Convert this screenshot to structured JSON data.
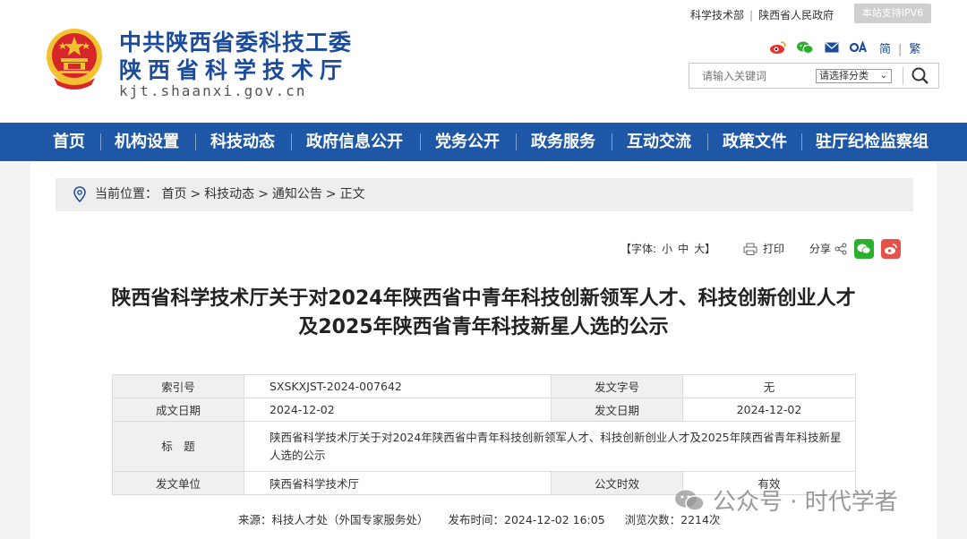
{
  "site": {
    "title_line1": "中共陕西省委科技工委",
    "title_line2": "陕西省科学技术厅",
    "url": "kjt.shaanxi.gov.cn"
  },
  "toplinks": {
    "link1": "科学技术部",
    "link2": "陕西省人民政府",
    "ipv6": "本站支持IPV6"
  },
  "lang": {
    "simplified": "简",
    "traditional": "繁"
  },
  "search": {
    "placeholder": "请输入关键词",
    "category": "请选择分类"
  },
  "nav": [
    "首页",
    "机构设置",
    "科技动态",
    "政府信息公开",
    "党务公开",
    "政务服务",
    "互动交流",
    "政策文件",
    "驻厅纪检监察组"
  ],
  "breadcrumb": {
    "label": "当前位置：",
    "items": [
      "首页",
      "科技动态",
      "通知公告",
      "正文"
    ],
    "sep": ">"
  },
  "tools": {
    "font_label": "【字体:",
    "small": "小",
    "medium": "中",
    "large": "大】",
    "print": "打印",
    "share": "分享"
  },
  "article": {
    "title_line1": "陕西省科学技术厅关于对2024年陕西省中青年科技创新领军人才、科技创新创业人才",
    "title_line2": "及2025年陕西省青年科技新星人选的公示"
  },
  "meta": {
    "index_label": "索引号",
    "index_value": "SXSKXJST-2024-007642",
    "docno_label": "发文字号",
    "docno_value": "无",
    "date_label": "成文日期",
    "date_value": "2024-12-02",
    "pubdate_label": "发文日期",
    "pubdate_value": "2024-12-02",
    "subject_label": "标　题",
    "subject_value": "陕西省科学技术厅关于对2024年陕西省中青年科技创新领军人才、科技创新创业人才及2025年陕西省青年科技新星人选的公示",
    "issuer_label": "发文单位",
    "issuer_value": "陕西省科学技术厅",
    "validity_label": "公文时效",
    "validity_value": "有效"
  },
  "source": {
    "source": "来源：科技人才处（外国专家服务处）",
    "published": "发布时间：2024-12-02 16:05",
    "views": "浏览次数：2214次"
  },
  "watermark": "公众号 · 时代学者",
  "colors": {
    "brand_blue": "#1c4c99",
    "nav_blue": "#1d57a6",
    "emblem_red": "#d7262a",
    "emblem_gold": "#f2c230",
    "wechat_green": "#2bb02b",
    "weibo_red": "#e6524a"
  }
}
